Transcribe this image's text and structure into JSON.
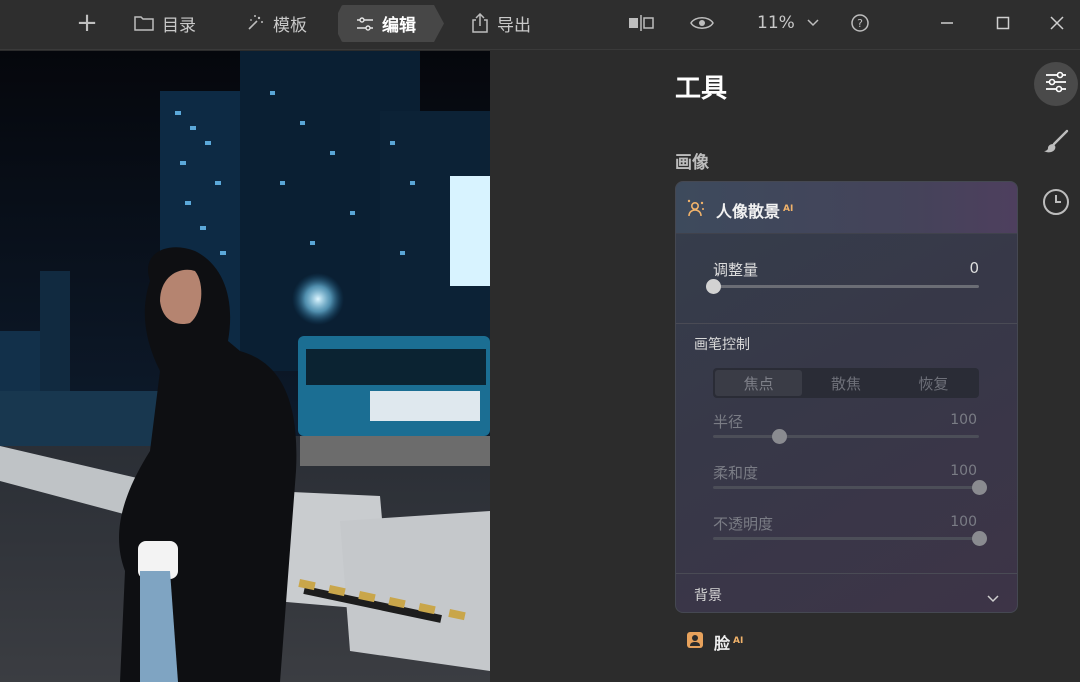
{
  "topbar": {
    "add_label": "+",
    "catalog_label": "目录",
    "template_label": "模板",
    "edit_label": "编辑",
    "export_label": "导出",
    "zoom_value": "11%"
  },
  "tools": {
    "title": "工具",
    "section_image": "画像"
  },
  "portrait_bokeh": {
    "title": "人像散景",
    "ai_badge": "AI",
    "amount_label": "调整量",
    "amount_value": "0",
    "amount_fraction": 0.0,
    "brush_control_label": "画笔控制",
    "brush_modes": [
      "焦点",
      "散焦",
      "恢复"
    ],
    "brush_mode_selected": "焦点",
    "radius_label": "半径",
    "radius_value": "100",
    "radius_fraction": 0.25,
    "softness_label": "柔和度",
    "softness_value": "100",
    "softness_fraction": 1.0,
    "opacity_label": "不透明度",
    "opacity_value": "100",
    "opacity_fraction": 1.0,
    "background_label": "背景"
  },
  "face": {
    "label": "脸",
    "ai_badge": "AI"
  },
  "colors": {
    "accent_orange": "#f0b26a",
    "panel_bg": "#373848",
    "app_bg": "#2c2c2c"
  },
  "icons": {
    "add": "plus-icon",
    "catalog": "folder-icon",
    "template": "sparkle-wand-icon",
    "edit": "sliders-icon",
    "export": "share-export-icon",
    "compare": "compare-icon",
    "preview": "eye-icon",
    "zoom_dropdown": "chevron-down-icon",
    "help": "help-circle-icon",
    "minimize": "minimize-icon",
    "maximize": "maximize-icon",
    "close": "close-icon",
    "side_tools": "sliders-icon",
    "side_brush": "brush-icon",
    "side_history": "clock-icon",
    "bokeh": "portrait-bokeh-icon",
    "face": "face-portrait-icon",
    "background_toggle": "chevron-down-icon"
  }
}
